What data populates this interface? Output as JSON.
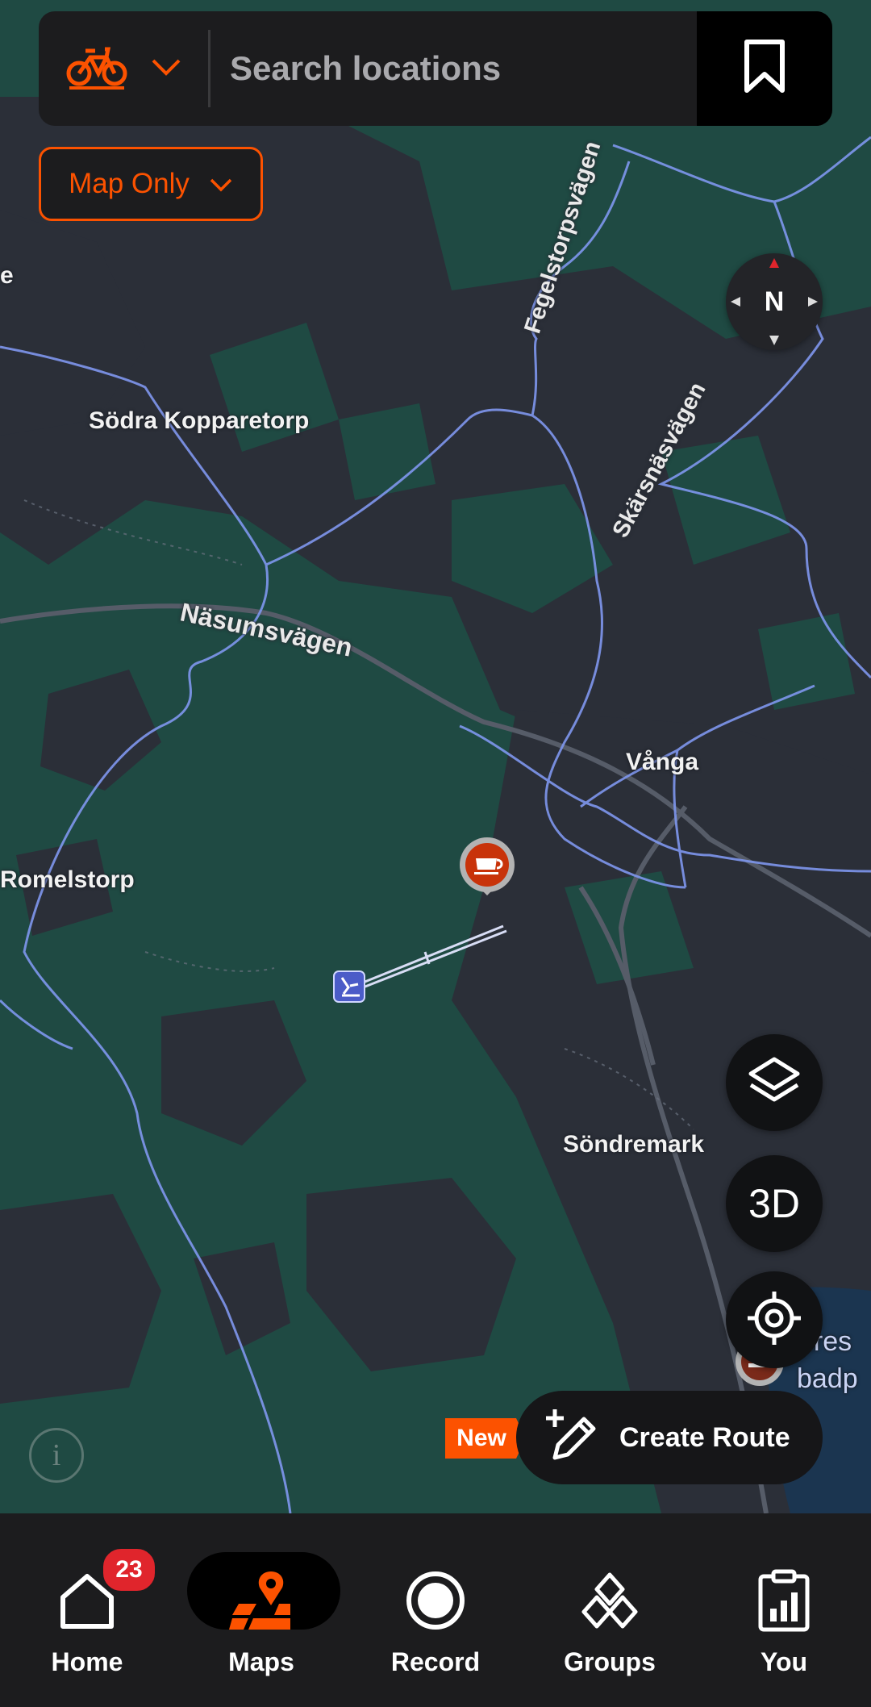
{
  "search": {
    "placeholder": "Search locations",
    "sport_icon": "bike-icon"
  },
  "filter": {
    "label": "Map Only"
  },
  "compass": {
    "label": "N"
  },
  "map": {
    "places": [
      {
        "name": "Södra Kopparetorp"
      },
      {
        "name": "Vånga"
      },
      {
        "name": "Romelstorp"
      },
      {
        "name": "Söndremark"
      },
      {
        "name": "e"
      },
      {
        "name": "ures"
      },
      {
        "name": "badp"
      }
    ],
    "roads": [
      {
        "name": "Fegelstorpsvägen"
      },
      {
        "name": "Skärsnäsvägen"
      },
      {
        "name": "Näsumsvägen"
      }
    ]
  },
  "controls": {
    "three_d_label": "3D"
  },
  "create_route": {
    "new_tag": "New",
    "label": "Create Route"
  },
  "nav": {
    "items": [
      {
        "label": "Home",
        "badge": "23"
      },
      {
        "label": "Maps"
      },
      {
        "label": "Record"
      },
      {
        "label": "Groups"
      },
      {
        "label": "You"
      }
    ]
  },
  "colors": {
    "accent": "#fc5200",
    "map_forest": "#1f4a43",
    "map_field": "#2c3039",
    "trail": "#7f97ee"
  }
}
